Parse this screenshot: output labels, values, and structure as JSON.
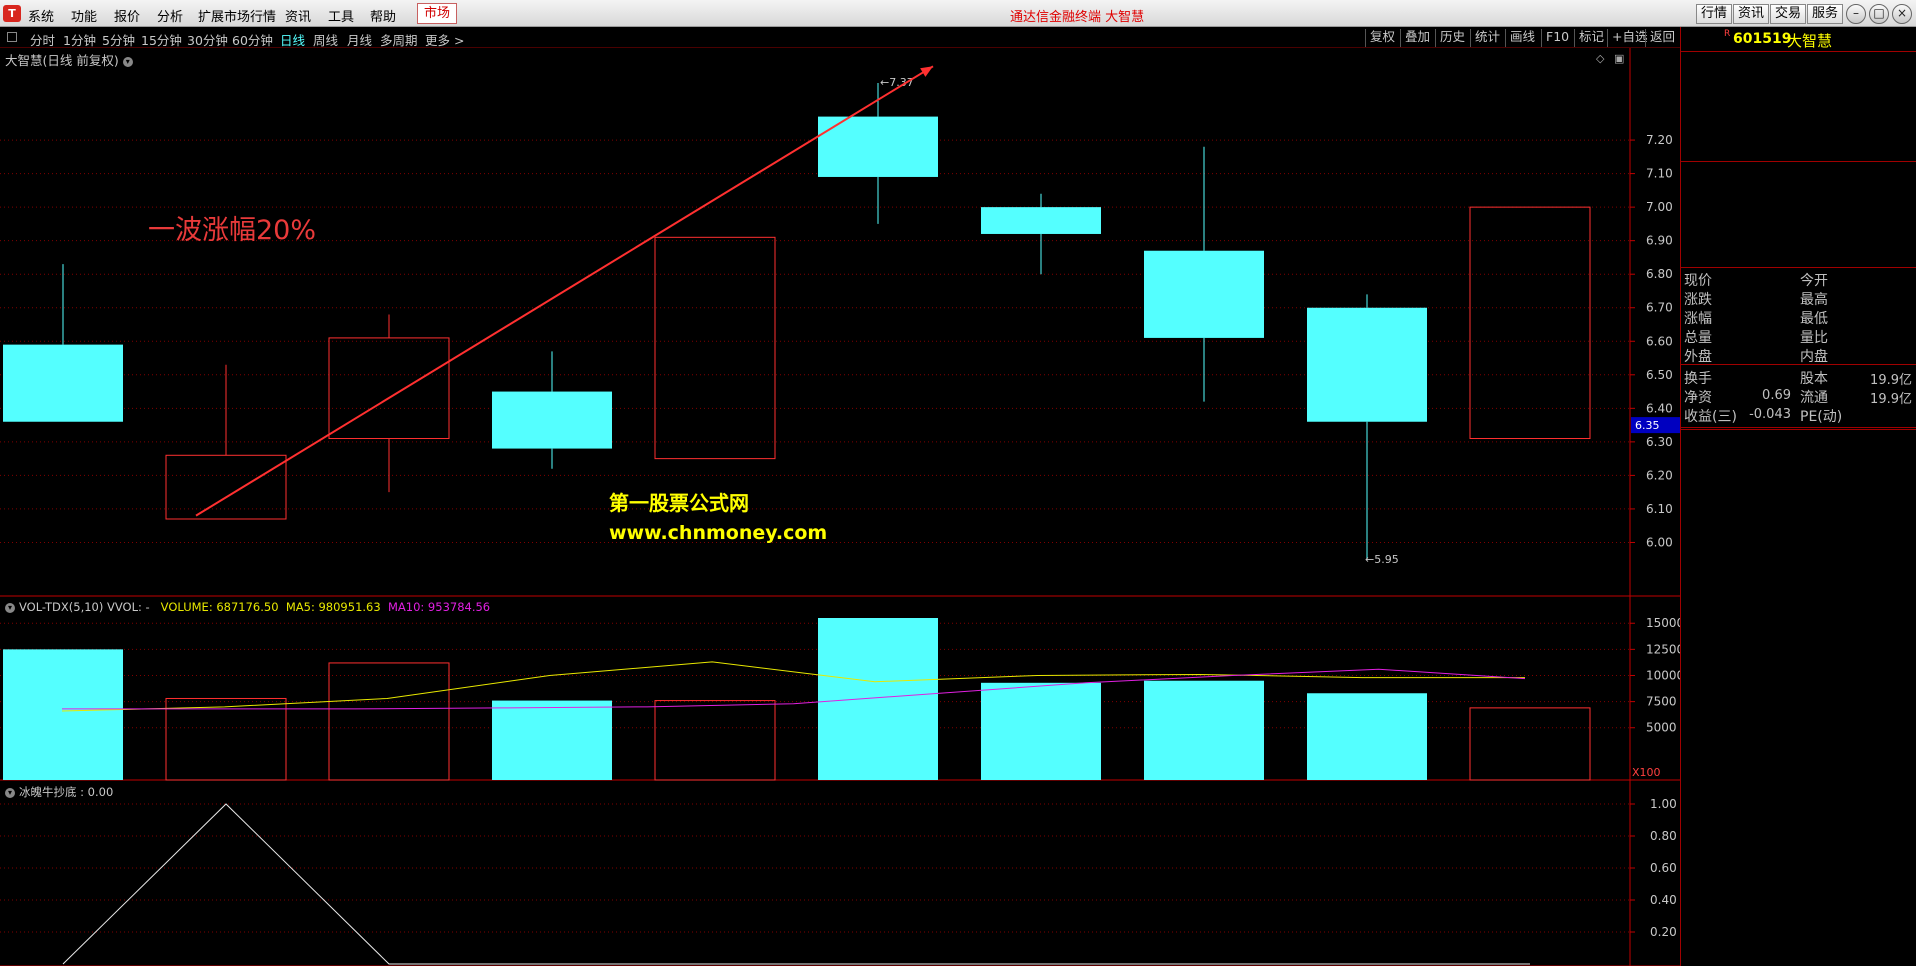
{
  "menubar": {
    "logo": "T",
    "items": [
      "系统",
      "功能",
      "报价",
      "分析",
      "扩展市场行情",
      "资讯",
      "工具",
      "帮助"
    ],
    "market_label": "市场",
    "title": "通达信金融终端  大智慧",
    "right_buttons": [
      "行情",
      "资讯",
      "交易",
      "服务"
    ]
  },
  "periodbar": {
    "periods": [
      "分时",
      "1分钟",
      "5分钟",
      "15分钟",
      "30分钟",
      "60分钟",
      "日线",
      "周线",
      "月线",
      "多周期",
      "更多 >"
    ],
    "active_period": "日线",
    "tools": [
      "复权",
      "叠加",
      "历史",
      "统计",
      "画线",
      "F10",
      "标记",
      "+自选",
      "返回"
    ]
  },
  "info": {
    "r_flag": "R",
    "code": "601519",
    "name": "大智慧",
    "fields_left": [
      "现价",
      "涨跌",
      "涨幅",
      "总量",
      "外盘",
      "换手",
      "净资",
      "收益(三)"
    ],
    "fields_right": [
      "今开",
      "最高",
      "最低",
      "量比",
      "内盘",
      "股本",
      "流通",
      "PE(动)"
    ],
    "values_left": {
      "净资": "0.69",
      "收益(三)": "-0.043"
    },
    "values_right": {
      "股本": "19.9亿",
      "流通": "19.9亿"
    }
  },
  "main_chart": {
    "title": "大智慧(日线 前复权)",
    "annotation": "一波涨幅20%",
    "watermark_cn": "第一股票公式网",
    "watermark_url": "www.chnmoney.com",
    "high_marker": "7.37",
    "low_marker": "5.95",
    "current_price_tag": "6.35",
    "y_ticks": [
      "7.20",
      "7.10",
      "7.00",
      "6.90",
      "6.80",
      "6.70",
      "6.60",
      "6.50",
      "6.40",
      "6.30",
      "6.20",
      "6.10",
      "6.00"
    ]
  },
  "volume_panel": {
    "name": "VOL-TDX(5,10)",
    "vvol": "VVOL: -",
    "volume": "VOLUME: 687176.50",
    "ma5": "MA5: 980951.63",
    "ma10": "MA10: 953784.56",
    "y_ticks": [
      "15000",
      "12500",
      "10000",
      "7500",
      "5000"
    ],
    "unit": "X100"
  },
  "indicator_panel": {
    "name": "冰魄牛抄底 : 0.00",
    "y_ticks": [
      "1.00",
      "0.80",
      "0.60",
      "0.40",
      "0.20"
    ]
  },
  "chart_data": [
    {
      "type": "candlestick",
      "title": "大智慧(日线 前复权)",
      "ylim": [
        5.9,
        7.4
      ],
      "candles": [
        {
          "open": 6.59,
          "close": 6.36,
          "high": 6.83,
          "low": 6.36,
          "color": "down"
        },
        {
          "open": 6.07,
          "close": 6.26,
          "high": 6.53,
          "low": 6.07,
          "color": "up"
        },
        {
          "open": 6.31,
          "close": 6.61,
          "high": 6.68,
          "low": 6.15,
          "color": "up"
        },
        {
          "open": 6.45,
          "close": 6.28,
          "high": 6.57,
          "low": 6.22,
          "color": "down"
        },
        {
          "open": 6.25,
          "close": 6.91,
          "high": 6.91,
          "low": 6.25,
          "color": "up"
        },
        {
          "open": 7.27,
          "close": 7.09,
          "high": 7.37,
          "low": 6.95,
          "color": "down"
        },
        {
          "open": 7.0,
          "close": 6.92,
          "high": 7.04,
          "low": 6.8,
          "color": "down"
        },
        {
          "open": 6.87,
          "close": 6.61,
          "high": 7.18,
          "low": 6.42,
          "color": "down"
        },
        {
          "open": 6.7,
          "close": 6.36,
          "high": 6.74,
          "low": 5.95,
          "color": "down"
        },
        {
          "open": 6.31,
          "close": 7.0,
          "high": 7.0,
          "low": 6.31,
          "color": "up"
        }
      ]
    },
    {
      "type": "bar",
      "title": "VOL-TDX(5,10)",
      "unit": "X100",
      "ylim": [
        0,
        15500
      ],
      "values": [
        12500,
        7800,
        11200,
        7600,
        7600,
        15500,
        9300,
        9500,
        8300,
        6900
      ],
      "colors": [
        "down",
        "up",
        "up",
        "down",
        "up",
        "down",
        "down",
        "down",
        "down",
        "up"
      ],
      "series": [
        {
          "name": "MA5",
          "color": "#e8e800",
          "values": [
            6600,
            7000,
            7800,
            10000,
            11300,
            9400,
            10000,
            10100,
            9800,
            9800
          ]
        },
        {
          "name": "MA10",
          "color": "#e020e0",
          "values": [
            6800,
            6800,
            6800,
            6900,
            7000,
            7300,
            8300,
            9300,
            10000,
            10600,
            9700
          ]
        }
      ]
    },
    {
      "type": "line",
      "title": "冰魄牛抄底",
      "ylim": [
        0,
        1.05
      ],
      "values": [
        0,
        1.0,
        0,
        0,
        0,
        0,
        0,
        0,
        0,
        0
      ]
    }
  ],
  "colors": {
    "up": "#ff3030",
    "down": "#54ffff",
    "grid": "#800000",
    "axis": "#c00000"
  }
}
